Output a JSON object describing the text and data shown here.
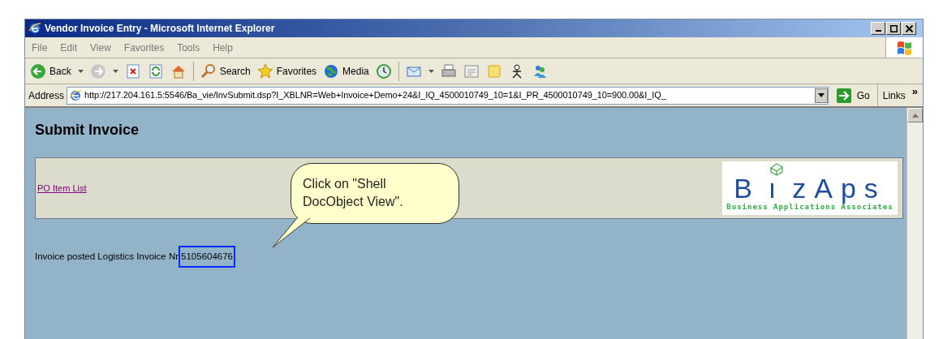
{
  "window": {
    "title": "Vendor Invoice Entry - Microsoft Internet Explorer"
  },
  "menu": [
    {
      "label": "File"
    },
    {
      "label": "Edit"
    },
    {
      "label": "View"
    },
    {
      "label": "Favorites"
    },
    {
      "label": "Tools"
    },
    {
      "label": "Help"
    }
  ],
  "toolbar": [
    {
      "kind": "back",
      "label": "Back"
    },
    {
      "kind": "forward"
    },
    {
      "kind": "stop"
    },
    {
      "kind": "refresh"
    },
    {
      "kind": "home"
    },
    {
      "kind": "sep"
    },
    {
      "kind": "search",
      "label": "Search"
    },
    {
      "kind": "favorites",
      "label": "Favorites"
    },
    {
      "kind": "media",
      "label": "Media"
    },
    {
      "kind": "history"
    },
    {
      "kind": "sep"
    },
    {
      "kind": "mail"
    },
    {
      "kind": "print"
    },
    {
      "kind": "edit"
    },
    {
      "kind": "note"
    },
    {
      "kind": "person"
    },
    {
      "kind": "messenger"
    }
  ],
  "address": {
    "label": "Address",
    "value": "http://217.204.161.5:5546/Ba_vie/InvSubmit.dsp?I_XBLNR=Web+Invoice+Demo+24&I_IQ_4500010749_10=1&I_PR_4500010749_10=900.00&I_IQ_",
    "go": "Go",
    "links": "Links",
    "chevron": "»"
  },
  "page": {
    "heading": "Submit Invoice",
    "link": "PO Item List",
    "logo": {
      "letters": [
        "B",
        "ı",
        "zAps"
      ],
      "tagline": "Business Applications Associates"
    },
    "message": "Invoice posted Logistics Invoice Nr",
    "invoice_number": "5105604676"
  },
  "callout": {
    "text": "Click on \"Shell DocObject View\"."
  }
}
